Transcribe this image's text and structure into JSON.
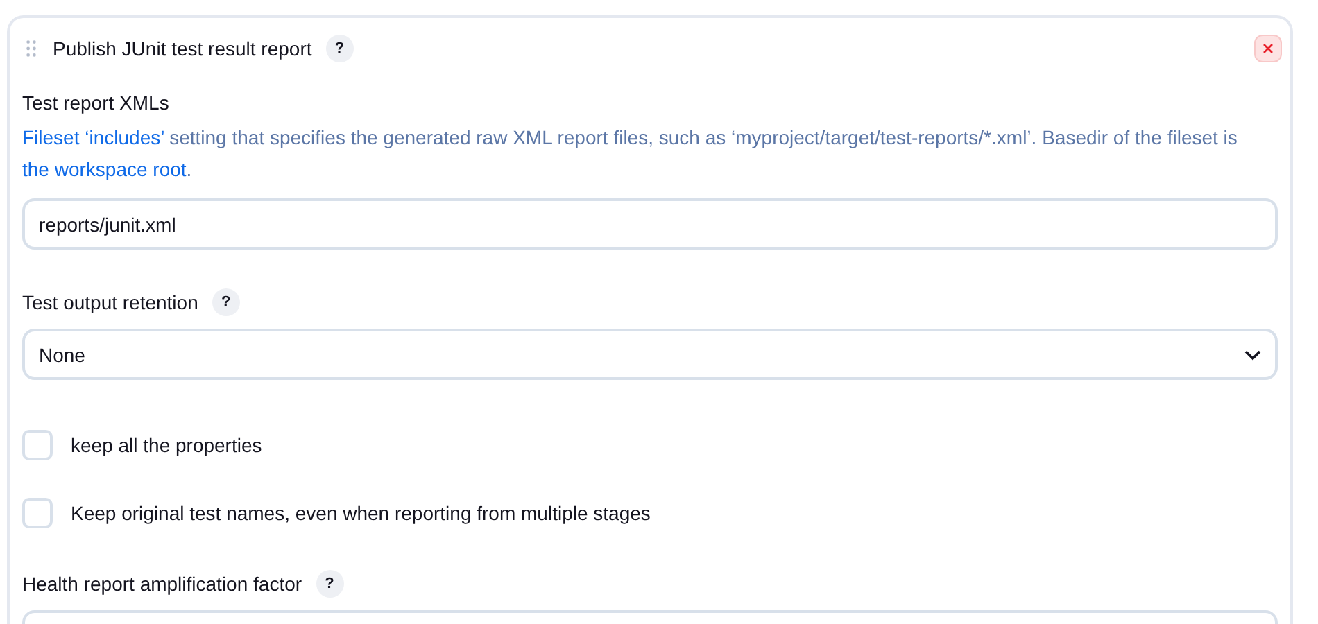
{
  "section": {
    "title": "Publish JUnit test result report",
    "help": "?"
  },
  "fields": [
    {
      "kind": "text",
      "label": "Test report XMLs",
      "description": [
        {
          "kind": "link",
          "text": "Fileset ‘includes’"
        },
        {
          "kind": "text",
          "text": " setting that specifies the generated raw XML report files, such as ‘myproject/target/test-reports/*.xml’. Basedir of the fileset is "
        },
        {
          "kind": "link",
          "text": "the workspace root"
        },
        {
          "kind": "text",
          "text": "."
        }
      ],
      "value": "reports/junit.xml"
    },
    {
      "kind": "select",
      "label": "Test output retention",
      "help": "?",
      "value": "None"
    },
    {
      "kind": "checkbox",
      "label": "keep all the properties",
      "checked": false
    },
    {
      "kind": "checkbox",
      "label": "Keep original test names, even when reporting from multiple stages",
      "checked": false
    },
    {
      "kind": "text",
      "label": "Health report amplification factor",
      "help": "?"
    }
  ]
}
